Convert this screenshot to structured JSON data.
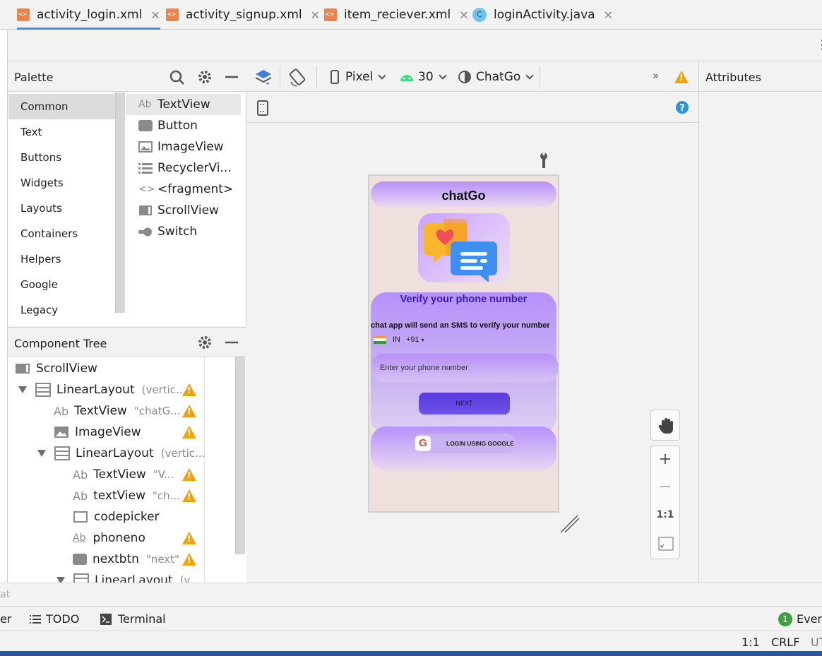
{
  "tabs": [
    {
      "label": "activity_login.xml",
      "type": "xml",
      "active": true
    },
    {
      "label": "activity_signup.xml",
      "type": "xml",
      "active": false
    },
    {
      "label": "item_reciever.xml",
      "type": "xml",
      "active": false
    },
    {
      "label": "loginActivity.java",
      "type": "java",
      "active": false
    }
  ],
  "tab_close_glyph": "✕",
  "palette": {
    "title": "Palette",
    "categories": [
      "Common",
      "Text",
      "Buttons",
      "Widgets",
      "Layouts",
      "Containers",
      "Helpers",
      "Google",
      "Legacy"
    ],
    "selected_category": "Common",
    "widgets": [
      {
        "label": "TextView",
        "icon": "textview-icon"
      },
      {
        "label": "Button",
        "icon": "button-icon"
      },
      {
        "label": "ImageView",
        "icon": "imageview-icon"
      },
      {
        "label": "RecyclerVi...",
        "icon": "recyclerview-icon"
      },
      {
        "label": "<fragment>",
        "icon": "fragment-icon"
      },
      {
        "label": "ScrollView",
        "icon": "scrollview-icon"
      },
      {
        "label": "Switch",
        "icon": "switch-icon"
      }
    ]
  },
  "component_tree": {
    "title": "Component Tree",
    "rows": [
      {
        "label": "ScrollView",
        "hint": "",
        "warning": false
      },
      {
        "label": "LinearLayout",
        "hint": "(vertic...",
        "warning": true
      },
      {
        "label": "TextView",
        "hint": "\"chatG...",
        "warning": true
      },
      {
        "label": "ImageView",
        "hint": "",
        "warning": true
      },
      {
        "label": "LinearLayout",
        "hint": "(vertic...",
        "warning": true
      },
      {
        "label": "TextView",
        "hint": "\"V...",
        "warning": true
      },
      {
        "label": "textView",
        "hint": "\"ch...",
        "warning": true
      },
      {
        "label": "codepicker",
        "hint": "",
        "warning": false
      },
      {
        "label": "phoneno",
        "hint": "",
        "warning": true
      },
      {
        "label": "nextbtn",
        "hint": "\"next\"",
        "warning": true
      },
      {
        "label": "LinearLayout",
        "hint": "(v...",
        "warning": false
      }
    ]
  },
  "design_toolbar": {
    "device": "Pixel",
    "api_level": "30",
    "theme": "ChatGo",
    "overflow": "»"
  },
  "attributes": {
    "title": "Attributes"
  },
  "preview": {
    "app_title": "chatGo",
    "verify_title": "Verify your phone number",
    "sms_text": "chat app will send an SMS to verify your number",
    "country_code": "IN",
    "dial_code": "+91",
    "phone_hint": "Enter your phone number",
    "next_label": "NEXT",
    "google_label": "LOGIN USING GOOGLE",
    "google_glyph": "G"
  },
  "zoom": {
    "actual_size": "1:1",
    "zoom_in": "+",
    "zoom_out": "−"
  },
  "bottom_tools": [
    {
      "label": "TODO",
      "icon": "list-icon"
    },
    {
      "label": "Terminal",
      "icon": "terminal-icon"
    }
  ],
  "bottom_left_cut": "er",
  "event_log": {
    "count": "1",
    "label": "Even"
  },
  "status": {
    "position": "1:1",
    "line_sep": "CRLF",
    "encoding_cut": "UT"
  },
  "msg_left_cut": "at",
  "colors": {
    "accent": "#4a86e8",
    "warning": "#f0a30a",
    "brand_purple": "#b692fb",
    "heading_purple": "#3a1aa8"
  }
}
